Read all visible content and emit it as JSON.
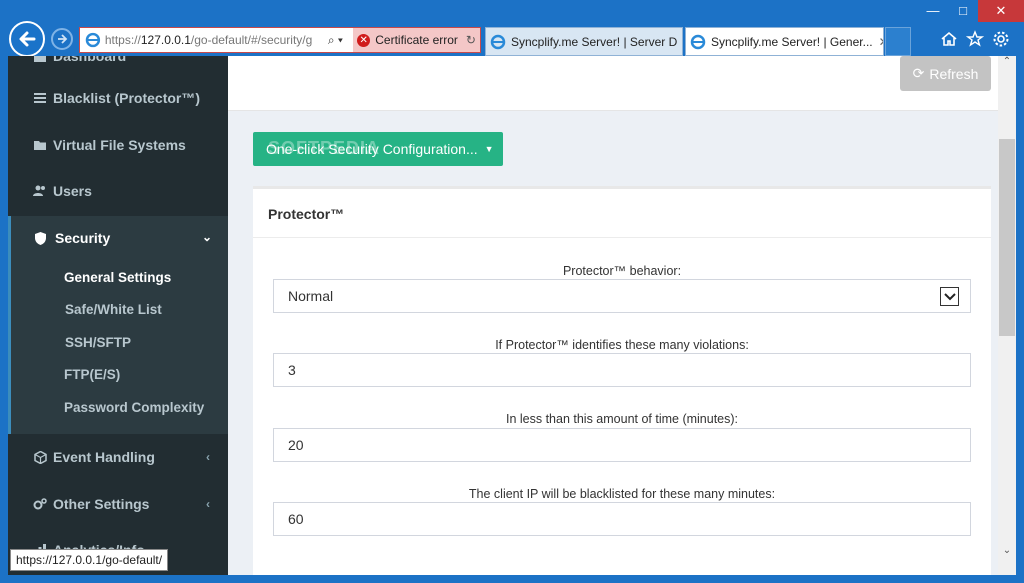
{
  "browser": {
    "url_prefix": "https://",
    "url_host": "127.0.0.1",
    "url_path": "/go-default/#/security/g",
    "search_dropdown": "⌕ ▾",
    "cert_error": "Certificate error",
    "tabs": [
      {
        "label": "Syncplify.me Server! | Server D"
      },
      {
        "label": "Syncplify.me Server! | Gener...",
        "close": "✕"
      }
    ],
    "status_url": "https://127.0.0.1/go-default/"
  },
  "sidebar": {
    "items": [
      {
        "label": "Dashboard"
      },
      {
        "label": "Blacklist (Protector™)"
      },
      {
        "label": "Virtual File Systems"
      },
      {
        "label": "Users"
      }
    ],
    "security": {
      "label": "Security",
      "subitems": [
        {
          "label": "General Settings"
        },
        {
          "label": "Safe/White List"
        },
        {
          "label": "SSH/SFTP"
        },
        {
          "label": "FTP(E/S)"
        },
        {
          "label": "Password Complexity"
        }
      ]
    },
    "bottom_items": [
      {
        "label": "Event Handling"
      },
      {
        "label": "Other Settings"
      },
      {
        "label": "Analytics/Info"
      }
    ]
  },
  "toolbar": {
    "refresh_label": "Refresh",
    "oneclick_label": "One-click Security Configuration..."
  },
  "watermark": "SOFTPEDIA",
  "protector": {
    "title": "Protector™",
    "fields": [
      {
        "label": "Protector™ behavior:",
        "value": "Normal"
      },
      {
        "label": "If Protector™ identifies these many violations:",
        "value": "3"
      },
      {
        "label": "In less than this amount of time (minutes):",
        "value": "20"
      },
      {
        "label": "The client IP will be blacklisted for these many minutes:",
        "value": "60"
      }
    ]
  },
  "colors": {
    "sidebar_bg": "#222d32",
    "accent_green": "#26b385",
    "browser_blue": "#1c72c6"
  }
}
